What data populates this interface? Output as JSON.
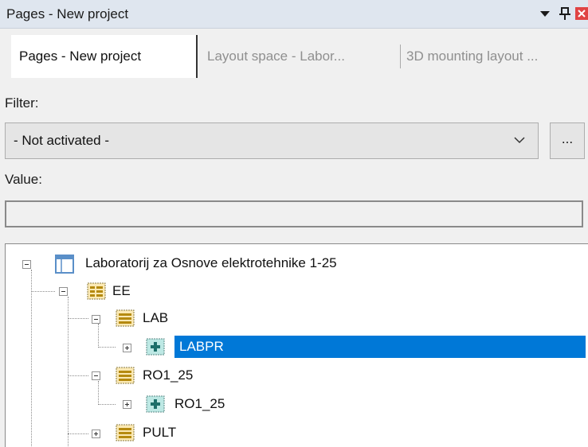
{
  "window": {
    "title": "Pages - New project",
    "dropdown_icon": "triangle-down-icon",
    "pin_icon": "pin-icon",
    "close_icon": "close-icon"
  },
  "tabs": [
    {
      "label": "Pages - New project",
      "active": true
    },
    {
      "label": "Layout space - Labor...",
      "active": false
    },
    {
      "label": "3D mounting layout ...",
      "active": false
    }
  ],
  "filter": {
    "label": "Filter:",
    "value": "- Not activated -",
    "more_button": "..."
  },
  "value": {
    "label": "Value:",
    "text": ""
  },
  "tree": {
    "nodes": [
      {
        "label": "Laboratorij za Osnove elektrotehnike 1-25",
        "icon": "project-icon",
        "expanded": true
      },
      {
        "label": "EE",
        "icon": "structure-folder-icon",
        "expanded": true
      },
      {
        "label": "LAB",
        "icon": "structure-folder-icon",
        "expanded": true
      },
      {
        "label": "LABPR",
        "icon": "location-icon",
        "expanded": false,
        "selected": true
      },
      {
        "label": "RO1_25",
        "icon": "structure-folder-icon",
        "expanded": true
      },
      {
        "label": "RO1_25",
        "icon": "location-icon",
        "expanded": false
      },
      {
        "label": "PULT",
        "icon": "structure-folder-icon",
        "expanded": false
      }
    ]
  },
  "colors": {
    "selection": "#0078d7",
    "close_button": "#e04343",
    "titlebar": "#dfe6ef"
  }
}
